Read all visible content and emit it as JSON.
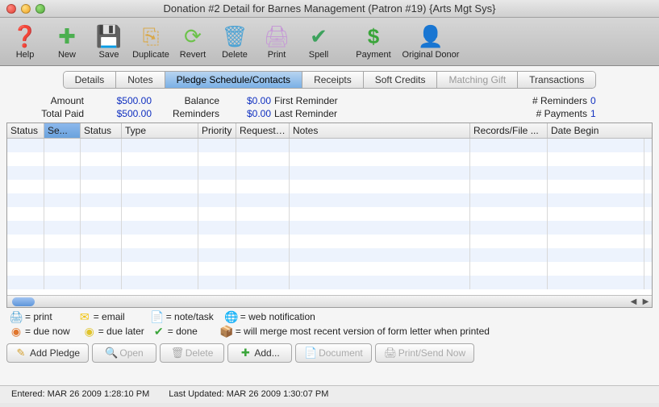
{
  "window": {
    "title": "Donation #2 Detail for Barnes Management (Patron #19) {Arts Mgt Sys}"
  },
  "toolbar": {
    "help": "Help",
    "new": "New",
    "save": "Save",
    "duplicate": "Duplicate",
    "revert": "Revert",
    "delete": "Delete",
    "print": "Print",
    "spell": "Spell",
    "payment": "Payment",
    "original_donor": "Original Donor"
  },
  "tabs": {
    "details": "Details",
    "notes": "Notes",
    "pledge": "Pledge Schedule/Contacts",
    "receipts": "Receipts",
    "soft_credits": "Soft Credits",
    "matching_gift": "Matching Gift",
    "transactions": "Transactions"
  },
  "summary": {
    "labels": {
      "amount": "Amount",
      "balance": "Balance",
      "first_reminder": "First Reminder",
      "num_reminders": "# Reminders",
      "total_paid": "Total Paid",
      "reminders": "Reminders",
      "last_reminder": "Last Reminder",
      "num_payments": "# Payments"
    },
    "values": {
      "amount": "$500.00",
      "balance": "$0.00",
      "first_reminder": "",
      "num_reminders": "0",
      "total_paid": "$500.00",
      "reminders": "$0.00",
      "last_reminder": "",
      "num_payments": "1"
    }
  },
  "columns": {
    "status": "Status",
    "se": "Se...",
    "status2": "Status",
    "type": "Type",
    "priority": "Priority",
    "requestor": "Requeste...",
    "notes": "Notes",
    "records": "Records/File ...",
    "date_begin": "Date Begin"
  },
  "legend": {
    "print": "= print",
    "email": "= email",
    "note_task": "= note/task",
    "web": "= web notification",
    "due_now": "= due now",
    "due_later": "= due later",
    "done": "= done",
    "merge": "= will merge most recent version of form letter when printed"
  },
  "buttons": {
    "add_pledge": "Add Pledge",
    "open": "Open",
    "delete": "Delete",
    "add": "Add...",
    "document": "Document",
    "print_send": "Print/Send Now"
  },
  "statusbar": {
    "entered_label": "Entered:",
    "entered": "MAR 26 2009 1:28:10 PM",
    "updated_label": "Last Updated:",
    "updated": "MAR 26 2009 1:30:07 PM"
  }
}
